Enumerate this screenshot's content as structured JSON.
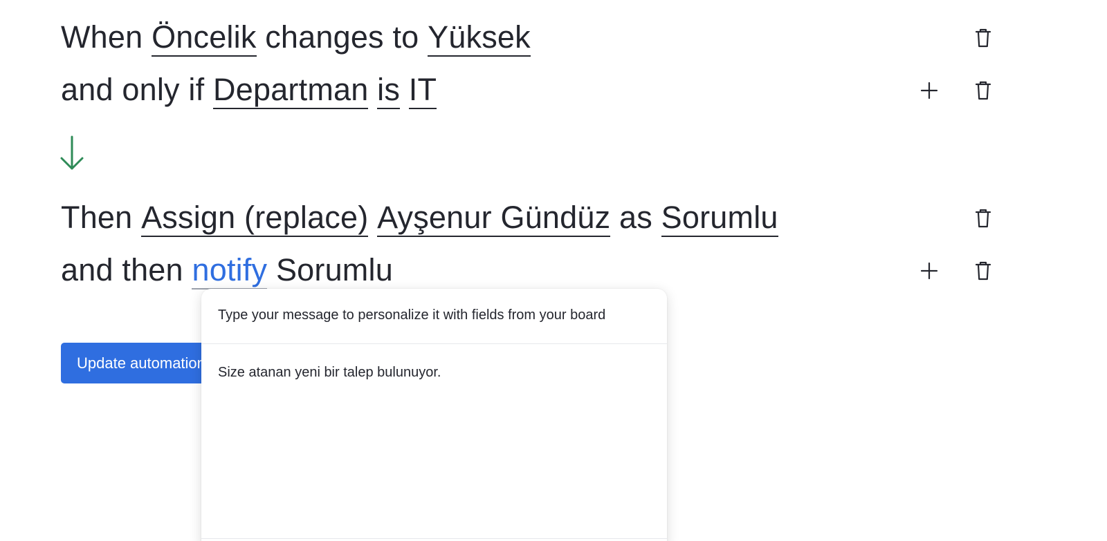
{
  "trigger": {
    "when_word": "When",
    "column": "Öncelik",
    "changes_to": "changes to",
    "value": "Yüksek"
  },
  "condition": {
    "prefix": "and only if",
    "column": "Departman",
    "operator": "is",
    "value": "IT"
  },
  "action": {
    "then_word": "Then",
    "verb": "Assign (replace)",
    "person": "Ayşenur Gündüz",
    "as_word": "as",
    "column": "Sorumlu"
  },
  "followup": {
    "prefix": "and then",
    "verb": "notify",
    "target": "Sorumlu"
  },
  "update_button_label": "Update automation",
  "message_popover": {
    "header": "Type your message to personalize it with fields from your board",
    "message_text": "Size atanan yeni bir talep bulunuyor."
  },
  "colors": {
    "accent": "#2f6ee0",
    "arrow": "#2e8b57",
    "text": "#24262e"
  },
  "icons": {
    "delete": "trash-icon",
    "add": "plus-icon",
    "flow": "arrow-down-icon"
  }
}
